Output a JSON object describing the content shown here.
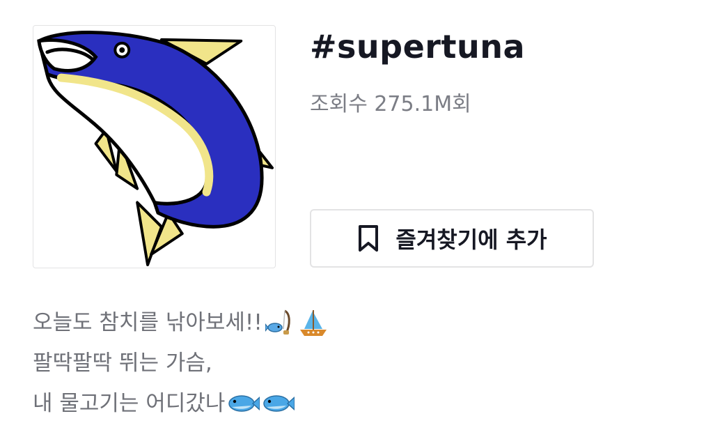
{
  "hashtag": {
    "title": "#supertuna",
    "views": "조회수 275.1M회"
  },
  "favorite_button": {
    "label": "즐겨찾기에 추가",
    "icon": "bookmark-icon"
  },
  "cover_image": {
    "icon": "tuna-fish-illustration",
    "colors": {
      "body_blue": "#2a2fbf",
      "fin_yellow": "#f1e58a",
      "outline": "#000000"
    }
  },
  "description": {
    "line1_text": "오늘도 참치를 낚아보세!! ",
    "line1_emojis": [
      "fishing-pole-icon",
      "sailboat-icon"
    ],
    "line2_text": "팔딱팔딱 뛰는 가슴,",
    "line3_text": "내 물고기는 어디갔나",
    "line3_emojis": [
      "fish-icon",
      "fish-icon"
    ]
  }
}
